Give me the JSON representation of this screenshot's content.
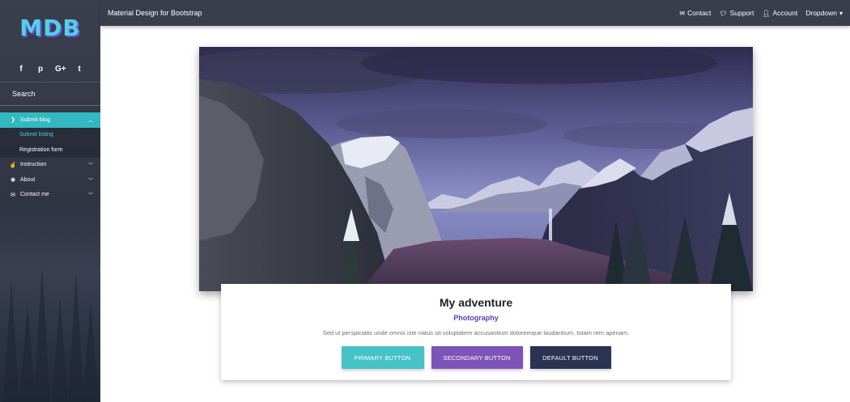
{
  "sidebar": {
    "logo": "MDB",
    "socials": [
      "f",
      "p",
      "G+",
      "t"
    ],
    "search_label": "Search",
    "menu": [
      {
        "label": "Submit blog",
        "icon": "chevron-right-icon",
        "expanded": true,
        "sub": [
          "Submit listing",
          "Registration form"
        ]
      },
      {
        "label": "Instruction",
        "icon": "hand-icon"
      },
      {
        "label": "About",
        "icon": "eye-icon"
      },
      {
        "label": "Contact me",
        "icon": "envelope-icon"
      }
    ]
  },
  "navbar": {
    "brand": "Material Design for Bootstrap",
    "links": [
      {
        "label": "Contact",
        "icon": "envelope-icon"
      },
      {
        "label": "Support",
        "icon": "comments-icon"
      },
      {
        "label": "Account",
        "icon": "user-icon"
      },
      {
        "label": "Dropdown",
        "icon": "caret-down-icon"
      }
    ]
  },
  "card": {
    "title": "My adventure",
    "subtitle": "Photography",
    "text": "Sed ut perspiciatis unde omnis iste natus sit voluptatem accusantium doloremque laudantium, totam rem aperiam.",
    "buttons": {
      "primary": "PRIMARY BUTTON",
      "secondary": "SECONDARY BUTTON",
      "default": "DEFAULT BUTTON"
    }
  },
  "colors": {
    "accent": "#31b8c0",
    "secondary": "#7e53b8",
    "dark": "#2a3352",
    "navbar": "#3a3d4c"
  }
}
